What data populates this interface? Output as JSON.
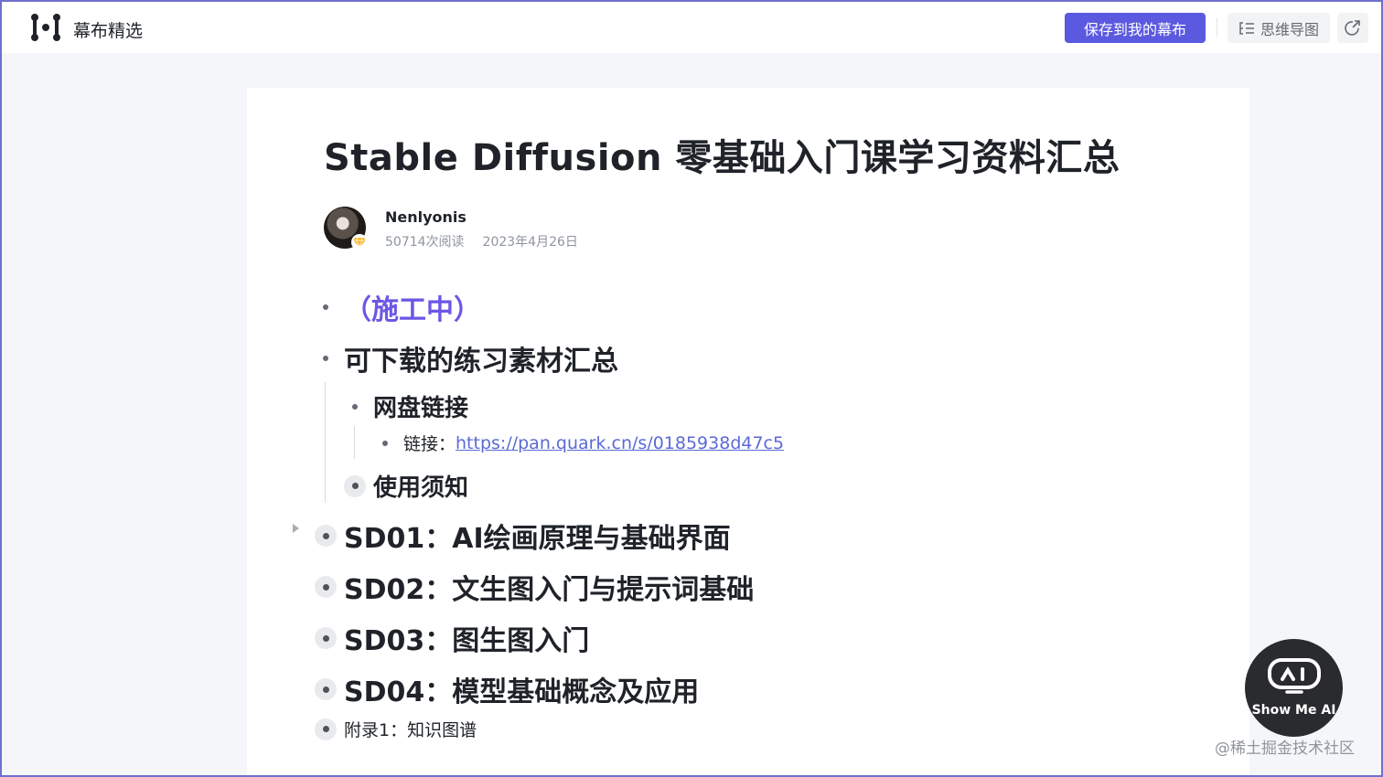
{
  "header": {
    "brand": "幕布精选",
    "save_label": "保存到我的幕布",
    "mindmap_label": "思维导图"
  },
  "doc": {
    "title": "Stable Diffusion 零基础入门课学习资料汇总",
    "author": "Nenlyonis",
    "reads": "50714次阅读",
    "date": "2023年4月26日"
  },
  "outline": [
    {
      "text": "（施工中）",
      "level": 1,
      "accent": true
    },
    {
      "text": "可下载的练习素材汇总",
      "level": 1
    },
    {
      "text": "网盘链接",
      "level": 2
    },
    {
      "text_label": "链接：",
      "link": "https://pan.quark.cn/s/0185938d47c5",
      "level": 3
    },
    {
      "text": "使用须知",
      "level": 2,
      "collapsed": true
    },
    {
      "text": "SD01：AI绘画原理与基础界面",
      "level": 1,
      "collapsed": true
    },
    {
      "text": "SD02：文生图入门与提示词基础",
      "level": 1,
      "collapsed": true
    },
    {
      "text": "SD03：图生图入门",
      "level": 1,
      "collapsed": true
    },
    {
      "text": "SD04：模型基础概念及应用",
      "level": 1,
      "collapsed": true
    },
    {
      "text": "附录1：知识图谱",
      "level": 1,
      "collapsed": true
    }
  ],
  "widget": {
    "label": "Show Me AI"
  },
  "watermark": "@稀土掘金技术社区",
  "icons": [
    "mubu-logo-icon",
    "mindmap-icon",
    "share-icon",
    "vip-diamond-icon",
    "show-me-ai-robot-icon",
    "expand-caret-icon"
  ],
  "colors": {
    "accent": "#5b59e0",
    "purple_text": "#6b57e6",
    "link": "#5b6ad6"
  }
}
